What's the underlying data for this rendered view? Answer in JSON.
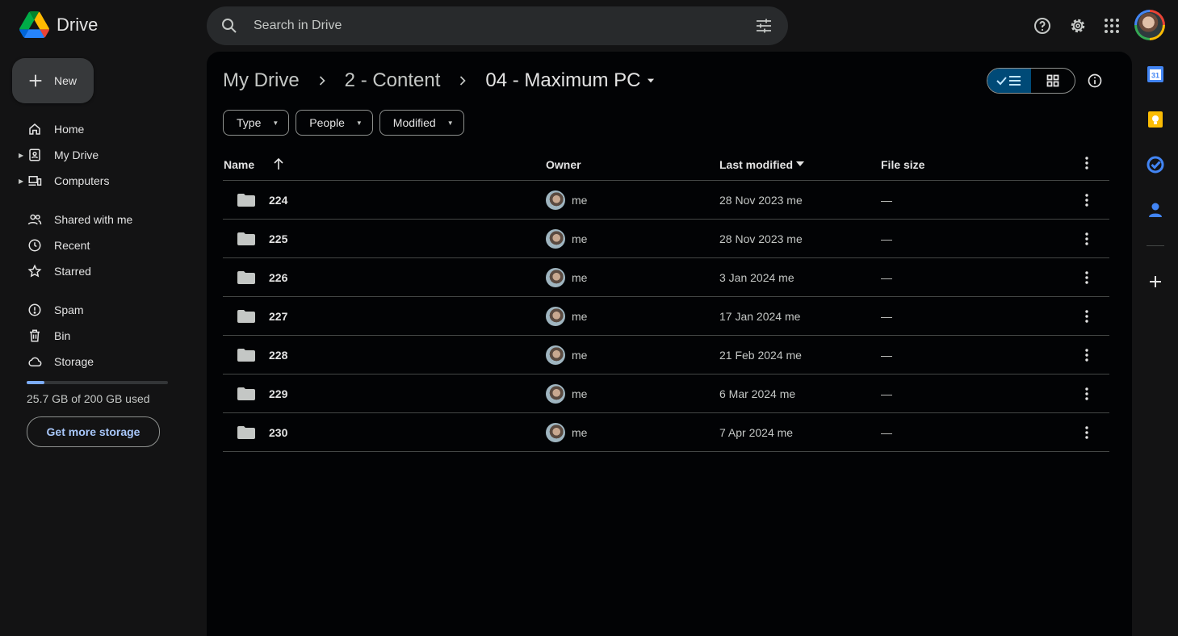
{
  "app": {
    "name": "Drive"
  },
  "search": {
    "placeholder": "Search in Drive"
  },
  "sidebar": {
    "new_label": "New",
    "items": [
      {
        "label": "Home",
        "icon": "home-icon"
      },
      {
        "label": "My Drive",
        "icon": "my-drive-icon"
      },
      {
        "label": "Computers",
        "icon": "computers-icon"
      },
      {
        "label": "Shared with me",
        "icon": "shared-icon"
      },
      {
        "label": "Recent",
        "icon": "clock-icon"
      },
      {
        "label": "Starred",
        "icon": "star-icon"
      },
      {
        "label": "Spam",
        "icon": "spam-icon"
      },
      {
        "label": "Bin",
        "icon": "trash-icon"
      },
      {
        "label": "Storage",
        "icon": "cloud-icon"
      }
    ],
    "storage": {
      "used_text": "25.7 GB of 200 GB used",
      "used_fraction": 0.1285,
      "button_label": "Get more storage"
    }
  },
  "breadcrumb": {
    "items": [
      "My Drive",
      "2 - Content"
    ],
    "current": "04 - Maximum PC"
  },
  "filters": [
    "Type",
    "People",
    "Modified"
  ],
  "table": {
    "headers": {
      "name": "Name",
      "owner": "Owner",
      "modified": "Last modified",
      "size": "File size"
    },
    "rows": [
      {
        "name": "224",
        "owner": "me",
        "modified": "28 Nov 2023 me",
        "size": "—"
      },
      {
        "name": "225",
        "owner": "me",
        "modified": "28 Nov 2023 me",
        "size": "—"
      },
      {
        "name": "226",
        "owner": "me",
        "modified": "3 Jan 2024 me",
        "size": "—"
      },
      {
        "name": "227",
        "owner": "me",
        "modified": "17 Jan 2024 me",
        "size": "—"
      },
      {
        "name": "228",
        "owner": "me",
        "modified": "21 Feb 2024 me",
        "size": "—"
      },
      {
        "name": "229",
        "owner": "me",
        "modified": "6 Mar 2024 me",
        "size": "—"
      },
      {
        "name": "230",
        "owner": "me",
        "modified": "7 Apr 2024 me",
        "size": "—"
      }
    ]
  },
  "right_rail": {
    "calendar_day": "31"
  },
  "colors": {
    "background": "#131314",
    "content": "#020305",
    "accent": "#a8c7fa",
    "toggle_active": "#004a77"
  }
}
